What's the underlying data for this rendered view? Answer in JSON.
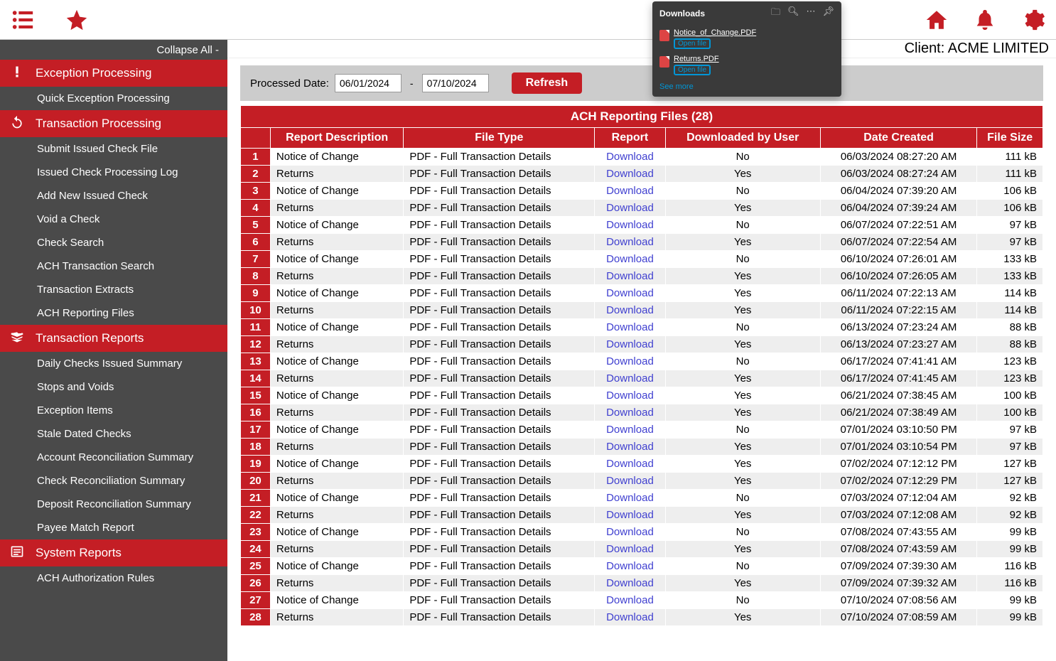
{
  "topbar": {
    "client_label": "Client: ACME LIMITED"
  },
  "sidebar": {
    "collapse_label": "Collapse All -",
    "sections": [
      {
        "label": "Exception Processing",
        "items": [
          "Quick Exception Processing"
        ]
      },
      {
        "label": "Transaction Processing",
        "items": [
          "Submit Issued Check File",
          "Issued Check Processing Log",
          "Add New Issued Check",
          "Void a Check",
          "Check Search",
          "ACH Transaction Search",
          "Transaction Extracts",
          "ACH Reporting Files"
        ]
      },
      {
        "label": "Transaction Reports",
        "items": [
          "Daily Checks Issued Summary",
          "Stops and Voids",
          "Exception Items",
          "Stale Dated Checks",
          "Account Reconciliation Summary",
          "Check Reconciliation Summary",
          "Deposit Reconciliation Summary",
          "Payee Match Report"
        ]
      },
      {
        "label": "System Reports",
        "items": [
          "ACH Authorization Rules"
        ]
      }
    ]
  },
  "filter": {
    "label": "Processed Date:",
    "date_from": "06/01/2024",
    "date_to": "07/10/2024",
    "refresh_label": "Refresh"
  },
  "table": {
    "title": "ACH Reporting Files (28)",
    "headers": [
      "Report Description",
      "File Type",
      "Report",
      "Downloaded by User",
      "Date Created",
      "File Size"
    ],
    "download_label": "Download",
    "rows": [
      {
        "n": 1,
        "desc": "Notice of Change",
        "type": "PDF - Full Transaction Details",
        "user": "No",
        "date": "06/03/2024 08:27:20 AM",
        "size": "111 kB"
      },
      {
        "n": 2,
        "desc": "Returns",
        "type": "PDF - Full Transaction Details",
        "user": "Yes",
        "date": "06/03/2024 08:27:24 AM",
        "size": "111 kB"
      },
      {
        "n": 3,
        "desc": "Notice of Change",
        "type": "PDF - Full Transaction Details",
        "user": "No",
        "date": "06/04/2024 07:39:20 AM",
        "size": "106 kB"
      },
      {
        "n": 4,
        "desc": "Returns",
        "type": "PDF - Full Transaction Details",
        "user": "Yes",
        "date": "06/04/2024 07:39:24 AM",
        "size": "106 kB"
      },
      {
        "n": 5,
        "desc": "Notice of Change",
        "type": "PDF - Full Transaction Details",
        "user": "No",
        "date": "06/07/2024 07:22:51 AM",
        "size": "97 kB"
      },
      {
        "n": 6,
        "desc": "Returns",
        "type": "PDF - Full Transaction Details",
        "user": "Yes",
        "date": "06/07/2024 07:22:54 AM",
        "size": "97 kB"
      },
      {
        "n": 7,
        "desc": "Notice of Change",
        "type": "PDF - Full Transaction Details",
        "user": "No",
        "date": "06/10/2024 07:26:01 AM",
        "size": "133 kB"
      },
      {
        "n": 8,
        "desc": "Returns",
        "type": "PDF - Full Transaction Details",
        "user": "Yes",
        "date": "06/10/2024 07:26:05 AM",
        "size": "133 kB"
      },
      {
        "n": 9,
        "desc": "Notice of Change",
        "type": "PDF - Full Transaction Details",
        "user": "Yes",
        "date": "06/11/2024 07:22:13 AM",
        "size": "114 kB"
      },
      {
        "n": 10,
        "desc": "Returns",
        "type": "PDF - Full Transaction Details",
        "user": "Yes",
        "date": "06/11/2024 07:22:15 AM",
        "size": "114 kB"
      },
      {
        "n": 11,
        "desc": "Notice of Change",
        "type": "PDF - Full Transaction Details",
        "user": "No",
        "date": "06/13/2024 07:23:24 AM",
        "size": "88 kB"
      },
      {
        "n": 12,
        "desc": "Returns",
        "type": "PDF - Full Transaction Details",
        "user": "Yes",
        "date": "06/13/2024 07:23:27 AM",
        "size": "88 kB"
      },
      {
        "n": 13,
        "desc": "Notice of Change",
        "type": "PDF - Full Transaction Details",
        "user": "No",
        "date": "06/17/2024 07:41:41 AM",
        "size": "123 kB"
      },
      {
        "n": 14,
        "desc": "Returns",
        "type": "PDF - Full Transaction Details",
        "user": "Yes",
        "date": "06/17/2024 07:41:45 AM",
        "size": "123 kB"
      },
      {
        "n": 15,
        "desc": "Notice of Change",
        "type": "PDF - Full Transaction Details",
        "user": "Yes",
        "date": "06/21/2024 07:38:45 AM",
        "size": "100 kB"
      },
      {
        "n": 16,
        "desc": "Returns",
        "type": "PDF - Full Transaction Details",
        "user": "Yes",
        "date": "06/21/2024 07:38:49 AM",
        "size": "100 kB"
      },
      {
        "n": 17,
        "desc": "Notice of Change",
        "type": "PDF - Full Transaction Details",
        "user": "No",
        "date": "07/01/2024 03:10:50 PM",
        "size": "97 kB"
      },
      {
        "n": 18,
        "desc": "Returns",
        "type": "PDF - Full Transaction Details",
        "user": "Yes",
        "date": "07/01/2024 03:10:54 PM",
        "size": "97 kB"
      },
      {
        "n": 19,
        "desc": "Notice of Change",
        "type": "PDF - Full Transaction Details",
        "user": "Yes",
        "date": "07/02/2024 07:12:12 PM",
        "size": "127 kB"
      },
      {
        "n": 20,
        "desc": "Returns",
        "type": "PDF - Full Transaction Details",
        "user": "Yes",
        "date": "07/02/2024 07:12:29 PM",
        "size": "127 kB"
      },
      {
        "n": 21,
        "desc": "Notice of Change",
        "type": "PDF - Full Transaction Details",
        "user": "No",
        "date": "07/03/2024 07:12:04 AM",
        "size": "92 kB"
      },
      {
        "n": 22,
        "desc": "Returns",
        "type": "PDF - Full Transaction Details",
        "user": "Yes",
        "date": "07/03/2024 07:12:08 AM",
        "size": "92 kB"
      },
      {
        "n": 23,
        "desc": "Notice of Change",
        "type": "PDF - Full Transaction Details",
        "user": "No",
        "date": "07/08/2024 07:43:55 AM",
        "size": "99 kB"
      },
      {
        "n": 24,
        "desc": "Returns",
        "type": "PDF - Full Transaction Details",
        "user": "Yes",
        "date": "07/08/2024 07:43:59 AM",
        "size": "99 kB"
      },
      {
        "n": 25,
        "desc": "Notice of Change",
        "type": "PDF - Full Transaction Details",
        "user": "No",
        "date": "07/09/2024 07:39:30 AM",
        "size": "116 kB"
      },
      {
        "n": 26,
        "desc": "Returns",
        "type": "PDF - Full Transaction Details",
        "user": "Yes",
        "date": "07/09/2024 07:39:32 AM",
        "size": "116 kB"
      },
      {
        "n": 27,
        "desc": "Notice of Change",
        "type": "PDF - Full Transaction Details",
        "user": "No",
        "date": "07/10/2024 07:08:56 AM",
        "size": "99 kB"
      },
      {
        "n": 28,
        "desc": "Returns",
        "type": "PDF - Full Transaction Details",
        "user": "Yes",
        "date": "07/10/2024 07:08:59 AM",
        "size": "99 kB"
      }
    ]
  },
  "downloads_popup": {
    "title": "Downloads",
    "open_label": "Open file",
    "see_more": "See more",
    "files": [
      {
        "name": "Notice_of_Change.PDF"
      },
      {
        "name": "Returns.PDF"
      }
    ]
  }
}
